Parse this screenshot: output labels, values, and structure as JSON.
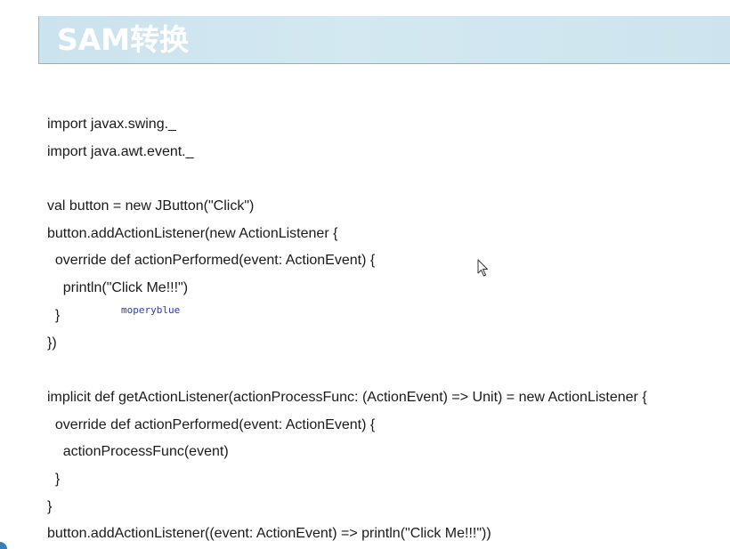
{
  "slide": {
    "title": "SAM转换",
    "code_lines": [
      "import javax.swing._",
      "import java.awt.event._",
      "",
      "val button = new JButton(\"Click\")",
      "button.addActionListener(new ActionListener {",
      "  override def actionPerformed(event: ActionEvent) {",
      "    println(\"Click Me!!!\")",
      "  }",
      "})",
      "",
      "implicit def getActionListener(actionProcessFunc: (ActionEvent) => Unit) = new ActionListener {",
      "  override def actionPerformed(event: ActionEvent) {",
      "    actionProcessFunc(event)",
      "  }",
      "}",
      "button.addActionListener((event: ActionEvent) => println(\"Click Me!!!\"))"
    ],
    "watermark": "moperyblue"
  },
  "colors": {
    "title_bar": "#cbe3ee",
    "title_text": "#ffffff",
    "code_text": "#1a1a1a",
    "watermark_text": "#2b3bb0"
  },
  "icons": {
    "cursor": "mouse-pointer-icon"
  }
}
